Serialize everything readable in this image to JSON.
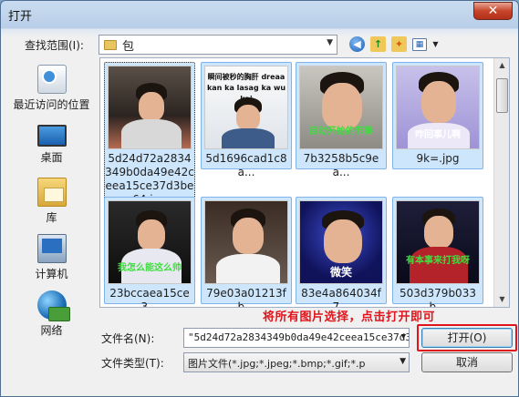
{
  "window": {
    "title": "打开",
    "close_glyph": "✕"
  },
  "lookin": {
    "label": "查找范围(I):",
    "value": "包"
  },
  "toolbar": {
    "icons": [
      "back-arrow-icon",
      "up-folder-icon",
      "new-folder-icon",
      "views-menu-icon"
    ]
  },
  "places": [
    {
      "label": "最近访问的位置",
      "icon": "recent-places-icon"
    },
    {
      "label": "桌面",
      "icon": "desktop-icon"
    },
    {
      "label": "库",
      "icon": "libraries-icon"
    },
    {
      "label": "计算机",
      "icon": "computer-icon"
    },
    {
      "label": "网络",
      "icon": "network-icon"
    }
  ],
  "files": [
    {
      "name": "5d24d72a2834349b0da49e42ceea15ce37d3be64.jpg",
      "selected": true,
      "caption": ""
    },
    {
      "name": "5d1696cad1c8a...",
      "selected": true,
      "caption": "瞬间被秒的胸肝 dreaa kan ka lasag ka wu kai"
    },
    {
      "name": "7b3258b5c9ea...",
      "selected": true,
      "caption": "自动开始的节奏"
    },
    {
      "name": "9k=.jpg",
      "selected": true,
      "caption": "咋回事儿啊"
    },
    {
      "name": "23bccaea15ce3...",
      "selected": true,
      "caption": "我怎么能这么帅"
    },
    {
      "name": "79e03a01213fb...",
      "selected": true,
      "caption": ""
    },
    {
      "name": "83e4a864034f7...",
      "selected": true,
      "caption": "微笑"
    },
    {
      "name": "503d379b033b...",
      "selected": true,
      "caption": "有本事来打我呀"
    }
  ],
  "filename": {
    "label": "文件名(N):",
    "value": "\"5d24d72a2834349b0da49e42ceea15ce37d3"
  },
  "filetype": {
    "label": "文件类型(T):",
    "value": "图片文件(*.jpg;*.jpeg;*.bmp;*.gif;*.p"
  },
  "buttons": {
    "open": "打开(O)",
    "cancel": "取消"
  },
  "annotation": "将所有图片选择，点击打开即可",
  "colors": {
    "highlight": "#e0141b",
    "selection": "#cde6fb"
  }
}
